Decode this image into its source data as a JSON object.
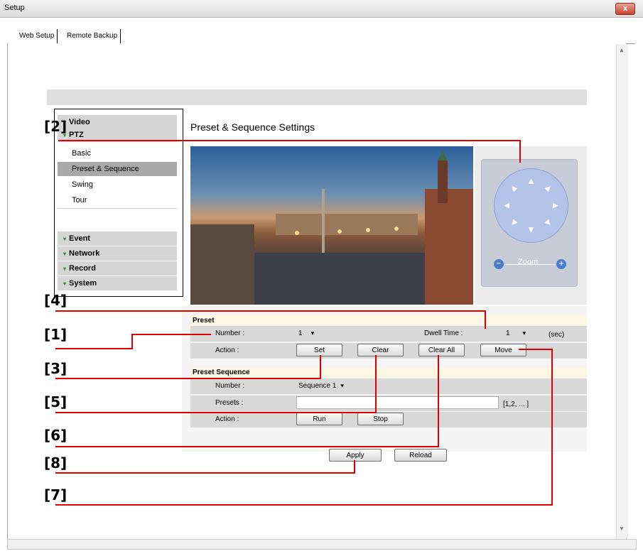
{
  "window": {
    "title": "Setup",
    "close_glyph": "x"
  },
  "tabs": [
    {
      "label": "Web Setup"
    },
    {
      "label": "Remote Backup"
    }
  ],
  "scrollbar": {
    "up_glyph": "▲",
    "down_glyph": "▼"
  },
  "menu": {
    "expand_glyph": "▾",
    "top": [
      {
        "label": "Video"
      },
      {
        "label": "PTZ"
      }
    ],
    "ptz_items": [
      {
        "label": "Basic"
      },
      {
        "label": "Preset & Sequence",
        "active": true
      },
      {
        "label": "Swing"
      },
      {
        "label": "Tour"
      }
    ],
    "bottom": [
      {
        "label": "Event"
      },
      {
        "label": "Network"
      },
      {
        "label": "Record"
      },
      {
        "label": "System"
      }
    ]
  },
  "page": {
    "title": "Preset & Sequence Settings"
  },
  "ptz": {
    "zoom_label": "Zoom",
    "zoom_out": "−",
    "zoom_in": "+",
    "arrow_glyph": "▲"
  },
  "preset": {
    "section_label": "Preset",
    "number_label": "Number :",
    "number_value": "1",
    "dwell_label": "Dwell Time :",
    "dwell_value": "1",
    "dwell_unit": "(sec)",
    "action_label": "Action :",
    "buttons": {
      "set": "Set",
      "clear": "Clear",
      "clear_all": "Clear All",
      "move": "Move"
    }
  },
  "preset_sequence": {
    "section_label": "Preset Sequence",
    "number_label": "Number :",
    "number_value": "Sequence 1",
    "presets_label": "Presets :",
    "presets_value": "",
    "presets_hint": "[1,2, ... ]",
    "action_label": "Action :",
    "buttons": {
      "run": "Run",
      "stop": "Stop"
    }
  },
  "footer_buttons": {
    "apply": "Apply",
    "reload": "Reload"
  },
  "dropdown_glyph": "▾",
  "annotations": [
    "[1]",
    "[2]",
    "[3]",
    "[4]",
    "[5]",
    "[6]",
    "[7]",
    "[8]"
  ],
  "colors": {
    "annotation_line": "#e00000",
    "active_menu": "#a9a9a9",
    "section_band": "#fdf6e2"
  }
}
